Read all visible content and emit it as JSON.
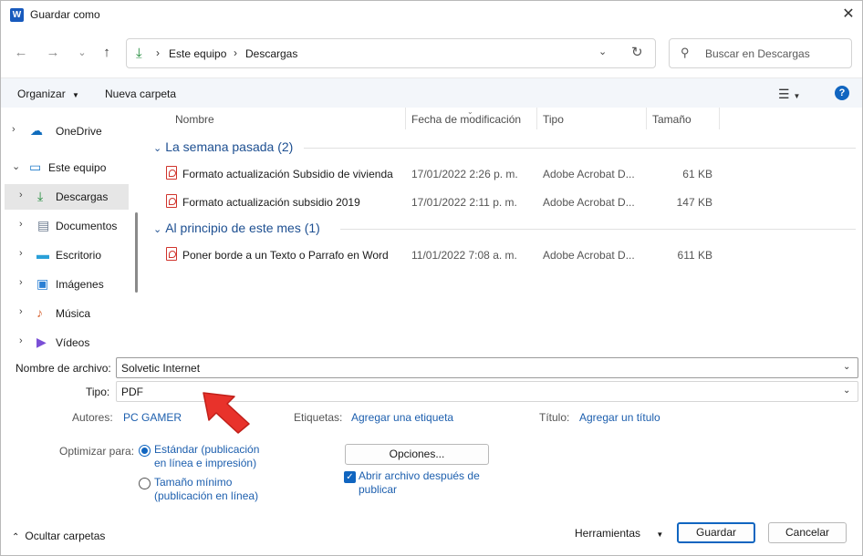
{
  "window": {
    "title": "Guardar como",
    "app_icon_letter": "W"
  },
  "nav": {
    "back": "←",
    "forward": "→",
    "recent": "⌄",
    "up": "↑",
    "breadcrumb": [
      "Este equipo",
      "Descargas"
    ],
    "search_placeholder": "Buscar en Descargas"
  },
  "toolbar": {
    "organize": "Organizar",
    "new_folder": "Nueva carpeta"
  },
  "sidebar": {
    "items": [
      {
        "label": "OneDrive",
        "icon": "cloud-icon",
        "color": "#0f6cbd"
      },
      {
        "label": "Este equipo",
        "icon": "monitor-icon",
        "color": "#1f7ac9"
      },
      {
        "label": "Descargas",
        "icon": "download-icon",
        "color": "#1f8a3a"
      },
      {
        "label": "Documentos",
        "icon": "document-icon",
        "color": "#6b7a8f"
      },
      {
        "label": "Escritorio",
        "icon": "desktop-icon",
        "color": "#2aa0d8"
      },
      {
        "label": "Imágenes",
        "icon": "image-icon",
        "color": "#2a7fd4"
      },
      {
        "label": "Música",
        "icon": "music-icon",
        "color": "#d86a3a"
      },
      {
        "label": "Vídeos",
        "icon": "video-icon",
        "color": "#7a4fd6"
      }
    ]
  },
  "columns": {
    "name": "Nombre",
    "date": "Fecha de modificación",
    "type": "Tipo",
    "size": "Tamaño"
  },
  "groups": [
    {
      "title": "La semana pasada (2)",
      "files": [
        {
          "name": "Formato actualización Subsidio de vivienda",
          "date": "17/01/2022 2:26 p. m.",
          "type": "Adobe Acrobat D...",
          "size": "61 KB"
        },
        {
          "name": "Formato actualización subsidio 2019",
          "date": "17/01/2022 2:11 p. m.",
          "type": "Adobe Acrobat D...",
          "size": "147 KB"
        }
      ]
    },
    {
      "title": "Al principio de este mes (1)",
      "files": [
        {
          "name": "Poner borde a un Texto o Parrafo en Word",
          "date": "11/01/2022 7:08 a. m.",
          "type": "Adobe Acrobat D...",
          "size": "611 KB"
        }
      ]
    }
  ],
  "form": {
    "filename_label": "Nombre de archivo:",
    "filename_value": "Solvetic Internet",
    "type_label": "Tipo:",
    "type_value": "PDF",
    "authors_label": "Autores:",
    "authors_value": "PC GAMER",
    "tags_label": "Etiquetas:",
    "tags_link": "Agregar una etiqueta",
    "title_label": "Título:",
    "title_link": "Agregar un título",
    "optimize_label": "Optimizar para:",
    "optimize_standard": [
      "Estándar (publicación",
      "en línea e impresión)"
    ],
    "optimize_min": [
      "Tamaño mínimo",
      "(publicación en línea)"
    ],
    "options_button": "Opciones...",
    "open_after": [
      "Abrir archivo después de",
      "publicar"
    ]
  },
  "footer": {
    "hide_folders": "Ocultar carpetas",
    "tools": "Herramientas",
    "save": "Guardar",
    "cancel": "Cancelar"
  },
  "colors": {
    "accent": "#1065c0",
    "link": "#1d5fae",
    "group_header": "#1d4f91",
    "pdf_red": "#d0342c",
    "annotation_arrow": "#e8322b"
  }
}
